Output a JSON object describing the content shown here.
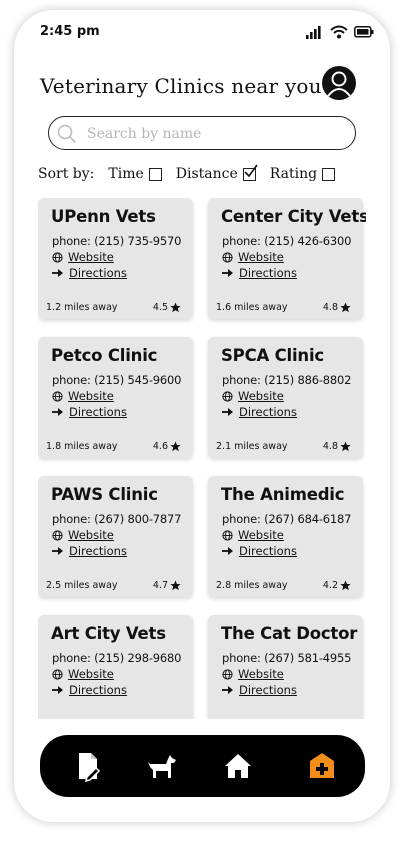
{
  "status": {
    "time": "2:45 pm"
  },
  "header": {
    "title": "Veterinary Clinics near you"
  },
  "search": {
    "placeholder": "Search by name",
    "value": ""
  },
  "sort": {
    "label": "Sort by:",
    "options": [
      {
        "label": "Time",
        "checked": false
      },
      {
        "label": "Distance",
        "checked": true
      },
      {
        "label": "Rating",
        "checked": false
      }
    ]
  },
  "clinics": [
    {
      "name": "UPenn Vets",
      "phone": "phone: (215) 735-9570",
      "website": "Website",
      "directions": "Directions",
      "distance": "1.2 miles away",
      "rating": "4.5"
    },
    {
      "name": "Center City Vets",
      "phone": "phone: (215) 426-6300",
      "website": "Website",
      "directions": "Directions",
      "distance": "1.6 miles away",
      "rating": "4.8"
    },
    {
      "name": "Petco Clinic",
      "phone": "phone: (215) 545-9600",
      "website": "Website",
      "directions": "Directions",
      "distance": "1.8 miles away",
      "rating": "4.6"
    },
    {
      "name": "SPCA Clinic",
      "phone": "phone: (215) 886-8802",
      "website": "Website",
      "directions": "Directions",
      "distance": "2.1 miles away",
      "rating": "4.8"
    },
    {
      "name": "PAWS Clinic",
      "phone": "phone: (267) 800-7877",
      "website": "Website",
      "directions": "Directions",
      "distance": "2.5 miles away",
      "rating": "4.7"
    },
    {
      "name": "The Animedic",
      "phone": "phone: (267) 684-6187",
      "website": "Website",
      "directions": "Directions",
      "distance": "2.8 miles away",
      "rating": "4.2"
    },
    {
      "name": "Art City Vets",
      "phone": "phone: (215) 298-9680",
      "website": "Website",
      "directions": "Directions",
      "distance": "",
      "rating": ""
    },
    {
      "name": "The Cat Doctor",
      "phone": "phone: (267) 581-4955",
      "website": "Website",
      "directions": "Directions",
      "distance": "",
      "rating": ""
    }
  ],
  "nav": {
    "items": [
      "records-icon",
      "pet-icon",
      "home-icon",
      "clinic-icon"
    ],
    "active": "clinic-icon",
    "active_color": "#f28c1b",
    "icon_color": "#ffffff"
  }
}
